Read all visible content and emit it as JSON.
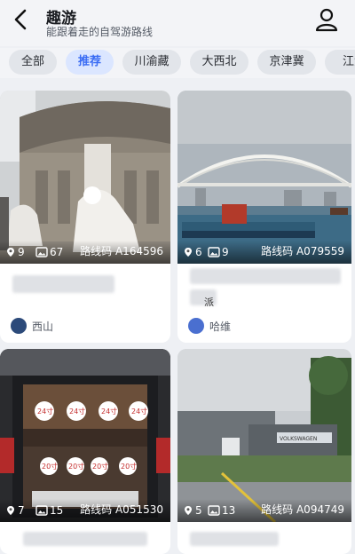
{
  "header": {
    "title": "趣游",
    "subtitle": "能跟着走的自驾游路线"
  },
  "tabs": [
    "全部",
    "推荐",
    "川渝藏",
    "大西北",
    "京津冀",
    "江浙"
  ],
  "active_tab": "推荐",
  "cards": [
    {
      "places": "9",
      "photos": "67",
      "route_label": "路线码",
      "route_code": "A164596",
      "author": "西山",
      "avatar_color": "#2c4a7a"
    },
    {
      "places": "6",
      "photos": "9",
      "route_label": "路线码",
      "route_code": "A079559",
      "author": "哈维",
      "avatar_color": "#4a6fd0"
    },
    {
      "places": "7",
      "photos": "15",
      "route_label": "路线码",
      "route_code": "A051530"
    },
    {
      "places": "5",
      "photos": "13",
      "route_label": "路线码",
      "route_code": "A094749"
    }
  ],
  "card2_fragment": "派",
  "trunk_signs": [
    "24寸",
    "24寸",
    "24寸",
    "24寸",
    "20寸",
    "20寸",
    "20寸",
    "20寸"
  ],
  "building_sign": "VOLKSWAGEN"
}
